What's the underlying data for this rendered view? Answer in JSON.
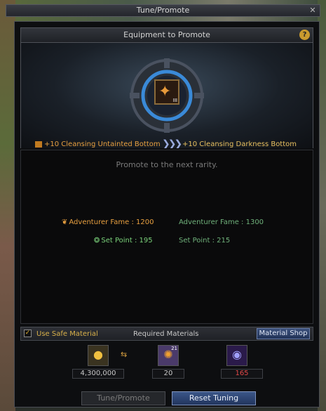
{
  "window": {
    "title": "Tune/Promote",
    "close_glyph": "✕"
  },
  "panel": {
    "title": "Equipment to Promote",
    "help_glyph": "?"
  },
  "promote": {
    "from_item": "+10 Cleansing Untainted Bottom",
    "to_item": "+10 Cleansing Darkness Bottom",
    "arrows": "❯❯❯"
  },
  "info": {
    "title": "Promote to the next rarity.",
    "adventurer_fame_label": "Adventurer Fame : 1200",
    "adventurer_fame_new": "Adventurer Fame : 1300",
    "set_point_label": "Set Point : 195",
    "set_point_new": "Set Point : 215"
  },
  "materials": {
    "safe_label": "Use Safe Material",
    "safe_checked": "✓",
    "required_label": "Required Materials",
    "shop_button": "Material Shop",
    "gold": "4,300,000",
    "item_a": "20",
    "item_b": "165",
    "item_a_badge": "21"
  },
  "buttons": {
    "tune": "Tune/Promote",
    "reset": "Reset Tuning"
  },
  "colors": {
    "rare_orange": "#e8a040",
    "new_green": "#6fb07a",
    "warning_red": "#e04848",
    "accent_blue": "#3b5688"
  }
}
